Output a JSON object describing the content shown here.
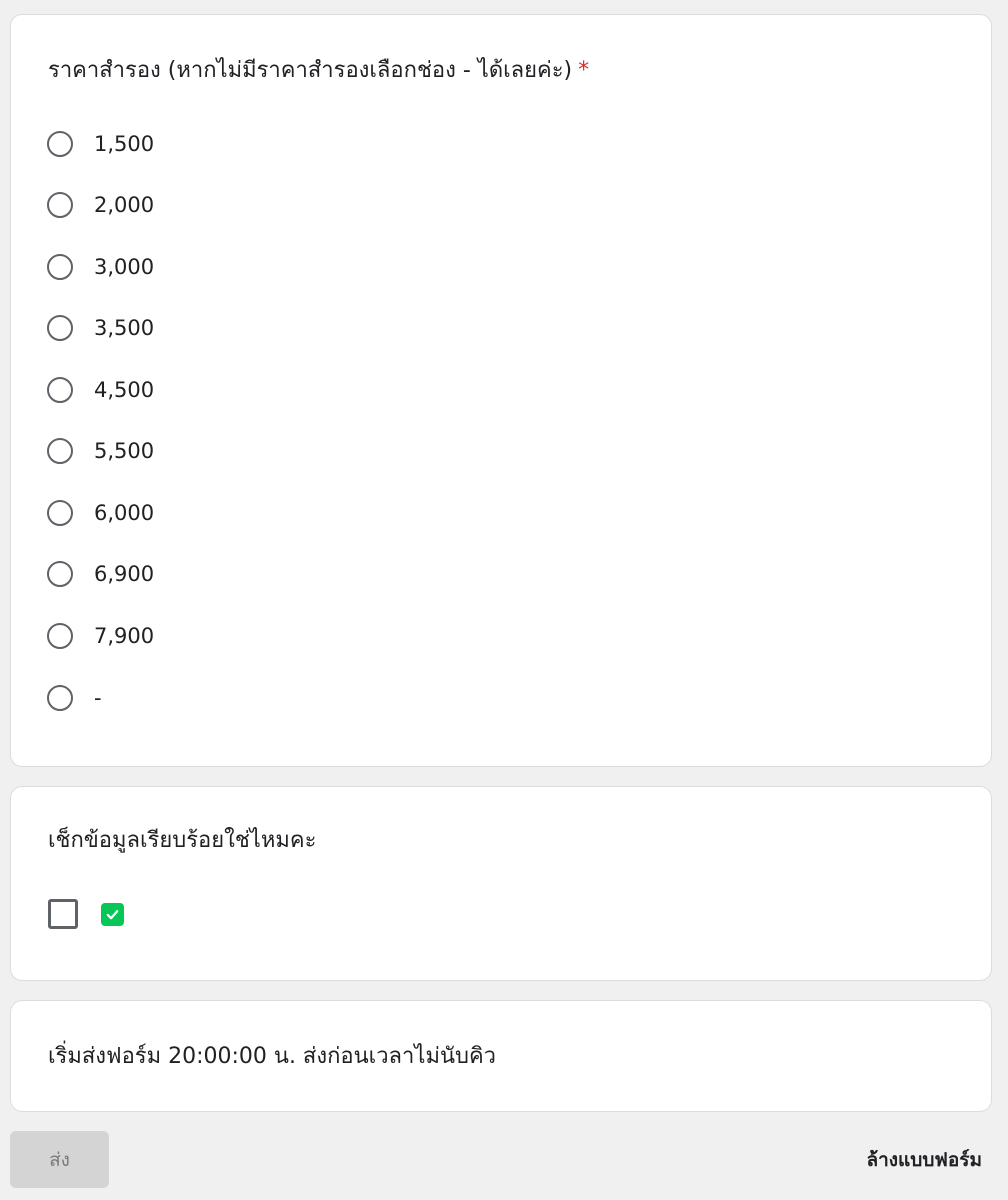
{
  "question_price": {
    "title": "ราคาสำรอง (หากไม่มีราคาสำรองเลือกช่อง - ได้เลยค่ะ)",
    "required_mark": "*",
    "options": [
      "1,500",
      "2,000",
      "3,000",
      "3,500",
      "4,500",
      "5,500",
      "6,000",
      "6,900",
      "7,900",
      "-"
    ]
  },
  "question_check": {
    "title": "เช็กข้อมูลเรียบร้อยใช่ไหมคะ",
    "option_icon": "green-checkmark-icon"
  },
  "note": {
    "text": "เริ่มส่งฟอร์ม 20:00:00 น. ส่งก่อนเวลาไม่นับคิว"
  },
  "footer": {
    "submit_label": "ส่ง",
    "clear_label": "ล้างแบบฟอร์ม"
  },
  "colors": {
    "required": "#d93025",
    "check_green": "#06c755",
    "submit_disabled_bg": "#d4d4d4"
  }
}
